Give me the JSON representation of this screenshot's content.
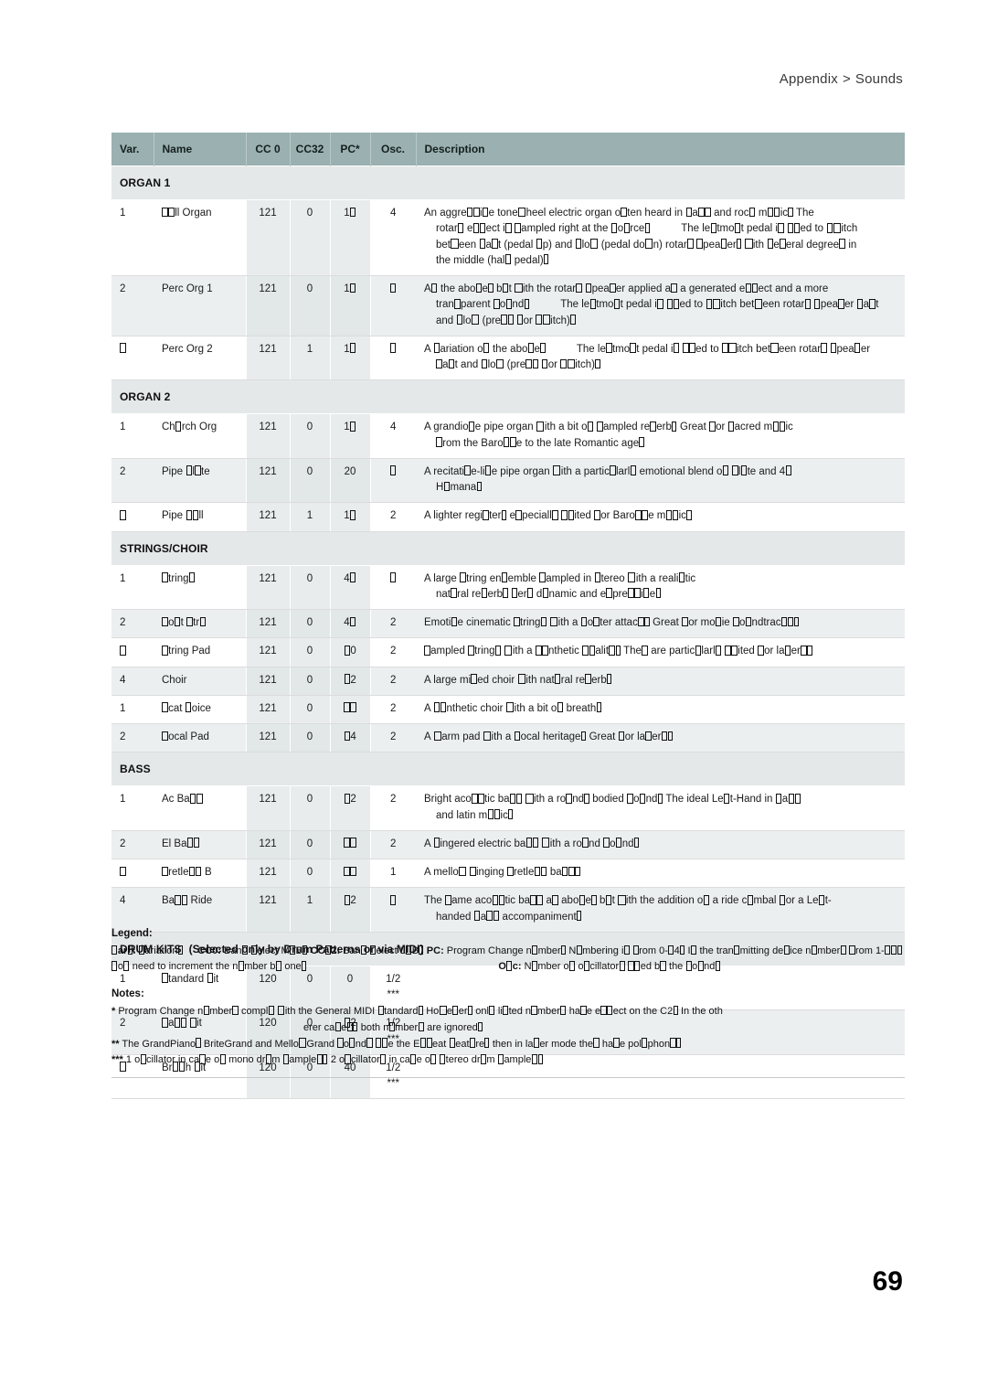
{
  "header": {
    "section": "Appendix",
    "separator": ">",
    "subsection": "Sounds"
  },
  "page_number": "69",
  "table": {
    "columns": [
      "Var.",
      "Name",
      "CC 0",
      "CC32",
      "PC*",
      "Osc.",
      "Description"
    ],
    "groups": [
      {
        "title": "ORGAN 1",
        "note": "",
        "rows": [
          {
            "var": "1",
            "name": "Full Organ",
            "cc0": "121",
            "cc32": "0",
            "pc": "16",
            "osc": "4",
            "desc": [
              "An aggressive tonewheel electric organ often heard in jazz and rock music. The",
              "rotary effect is sampled right at the source.  The leftmost pedal is used to switch",
              "between fast (pedal up) and slow (pedal down) rotary speaker, with several degrees in",
              "the middle (half pedal)."
            ]
          },
          {
            "var": "2",
            "name": "Perc Org 1",
            "cc0": "121",
            "cc32": "0",
            "pc": "16",
            "osc": "3",
            "desc": [
              "As the above, but with the rotary speaker applied as a generated effect and a more",
              "transparent sound.  The leftmost pedal is used to switch between rotary speaker fast",
              "and slow (press for switch)."
            ]
          },
          {
            "var": "3",
            "name": "Perc Org 2",
            "cc0": "121",
            "cc32": "1",
            "pc": "16",
            "osc": "3",
            "desc": [
              "A variation of the above.  The leftmost pedal is used to switch between rotary speaker",
              "fast and slow (press for switch)."
            ]
          }
        ]
      },
      {
        "title": "ORGAN 2",
        "note": "",
        "rows": [
          {
            "var": "1",
            "name": "Church Org",
            "cc0": "121",
            "cc32": "0",
            "pc": "19",
            "osc": "4",
            "desc": [
              "A grandiose pipe organ with a bit of sampled reverb. Great for sacred music",
              "from the Baroque to the late Romantic age."
            ]
          },
          {
            "var": "2",
            "name": "Pipe Flute",
            "cc0": "121",
            "cc32": "0",
            "pc": "20",
            "osc": "3",
            "desc": [
              "A recitative-like pipe organ with a particularly emotional blend of Flute and 4k",
              "Humana."
            ]
          },
          {
            "var": "3",
            "name": "Pipe Full",
            "cc0": "121",
            "cc32": "1",
            "pc": "19",
            "osc": "2",
            "desc": [
              "A lighter register, especially suited for Baroque music."
            ]
          }
        ]
      },
      {
        "title": "STRINGS/CHOIR",
        "note": "",
        "rows": [
          {
            "var": "1",
            "name": "Strings",
            "cc0": "121",
            "cc32": "0",
            "pc": "48",
            "osc": "3",
            "desc": [
              "A large string ensemble sampled in stereo with a realistic",
              "natural reverb. Very dynamic and expressive."
            ]
          },
          {
            "var": "2",
            "name": "Soft Strs",
            "cc0": "121",
            "cc32": "0",
            "pc": "48",
            "osc": "2",
            "desc": [
              "Emotive cinematic strings with a softer attack. Great for movie soundtracks."
            ]
          },
          {
            "var": "3",
            "name": "String Pad",
            "cc0": "121",
            "cc32": "0",
            "pc": "50",
            "osc": "2",
            "desc": [
              "Sampled strings with a synthetic quality. They are particularly suited for layers."
            ]
          },
          {
            "var": "4",
            "name": "Choir",
            "cc0": "121",
            "cc32": "0",
            "pc": "52",
            "osc": "2",
            "desc": [
              "A large mixed choir with natural reverb."
            ]
          },
          {
            "var": "1",
            "name": "Scat Voice",
            "cc0": "121",
            "cc32": "0",
            "pc": "53",
            "osc": "2",
            "desc": [
              "A synthetic choir with a bit of breath."
            ]
          },
          {
            "var": "2",
            "name": "Vocal Pad",
            "cc0": "121",
            "cc32": "0",
            "pc": "54",
            "osc": "2",
            "desc": [
              "A warm pad with a vocal heritage. Great for layers."
            ]
          }
        ]
      },
      {
        "title": "BASS",
        "note": "",
        "rows": [
          {
            "var": "1",
            "name": "Ac Bass",
            "cc0": "121",
            "cc32": "0",
            "pc": "32",
            "osc": "2",
            "desc": [
              "Bright acoustic bass with a round, bodied sound. The ideal Left-Hand in jazz",
              "and latin music."
            ]
          },
          {
            "var": "2",
            "name": "El Bass",
            "cc0": "121",
            "cc32": "0",
            "pc": "33",
            "osc": "2",
            "desc": [
              "A fingered electric bass with a round sound."
            ]
          },
          {
            "var": "3",
            "name": "Fretless B",
            "cc0": "121",
            "cc32": "0",
            "pc": "35",
            "osc": "1",
            "desc": [
              "A mellow singing fretless bass."
            ]
          },
          {
            "var": "4",
            "name": "Bass Ride",
            "cc0": "121",
            "cc32": "1",
            "pc": "32",
            "osc": "3",
            "desc": [
              "The same acoustic bass as above, but with the addition of a ride cymbal for a Left-",
              "handed jazz accompaniment."
            ]
          }
        ]
      },
      {
        "title": "DRUM KITS",
        "note": "(Selected only by Drum Patterns or via MIDI)",
        "rows": [
          {
            "var": "1",
            "name": "Standard Kit",
            "cc0": "120",
            "cc32": "0",
            "pc": "0",
            "osc": "1/2",
            "osc_note": "***",
            "desc": []
          },
          {
            "var": "2",
            "name": "Jazz Kit",
            "cc0": "120",
            "cc32": "0",
            "pc": "32",
            "osc": "1/2",
            "osc_note": "***",
            "desc": []
          },
          {
            "var": "3",
            "name": "Brush Kit",
            "cc0": "120",
            "cc32": "0",
            "pc": "40",
            "osc": "1/2",
            "osc_note": "***",
            "desc": []
          }
        ]
      }
    ]
  },
  "legend": {
    "title": "Legend:",
    "var_label": "Var.:",
    "var_text": "Variation.",
    "cc0_label": "CC0:",
    "cc0_text": "Bank Select MSB.",
    "cc32_label": "CC32:",
    "cc32_text": "Bank Select LSB.",
    "pc_label": "PC:",
    "pc_text": "Program Change number. Numbering is from 0-54. If the transmitting device numbers from 1-55, you need to increment the number by one.",
    "osc_label": "Osc:",
    "osc_text": "Number of oscillators used by the sound."
  },
  "notes": {
    "title": "Notes:",
    "items": [
      {
        "marker": "*",
        "text": "Program Change numbers comply with the General MIDI standard. However, only listed numbers have effect on the C2. In the other cases, both numbers are ignored."
      },
      {
        "marker": "**",
        "text": "The GrandPiano, BriteGrand and MellowGrand sounds use the ExSeat feature, then in layer mode they have polyphony."
      },
      {
        "marker": "***",
        "text": "1 oscillator in case of mono drum samples, 2 oscillators in case of stereo drum samples."
      }
    ],
    "stray_fragment": "er"
  }
}
